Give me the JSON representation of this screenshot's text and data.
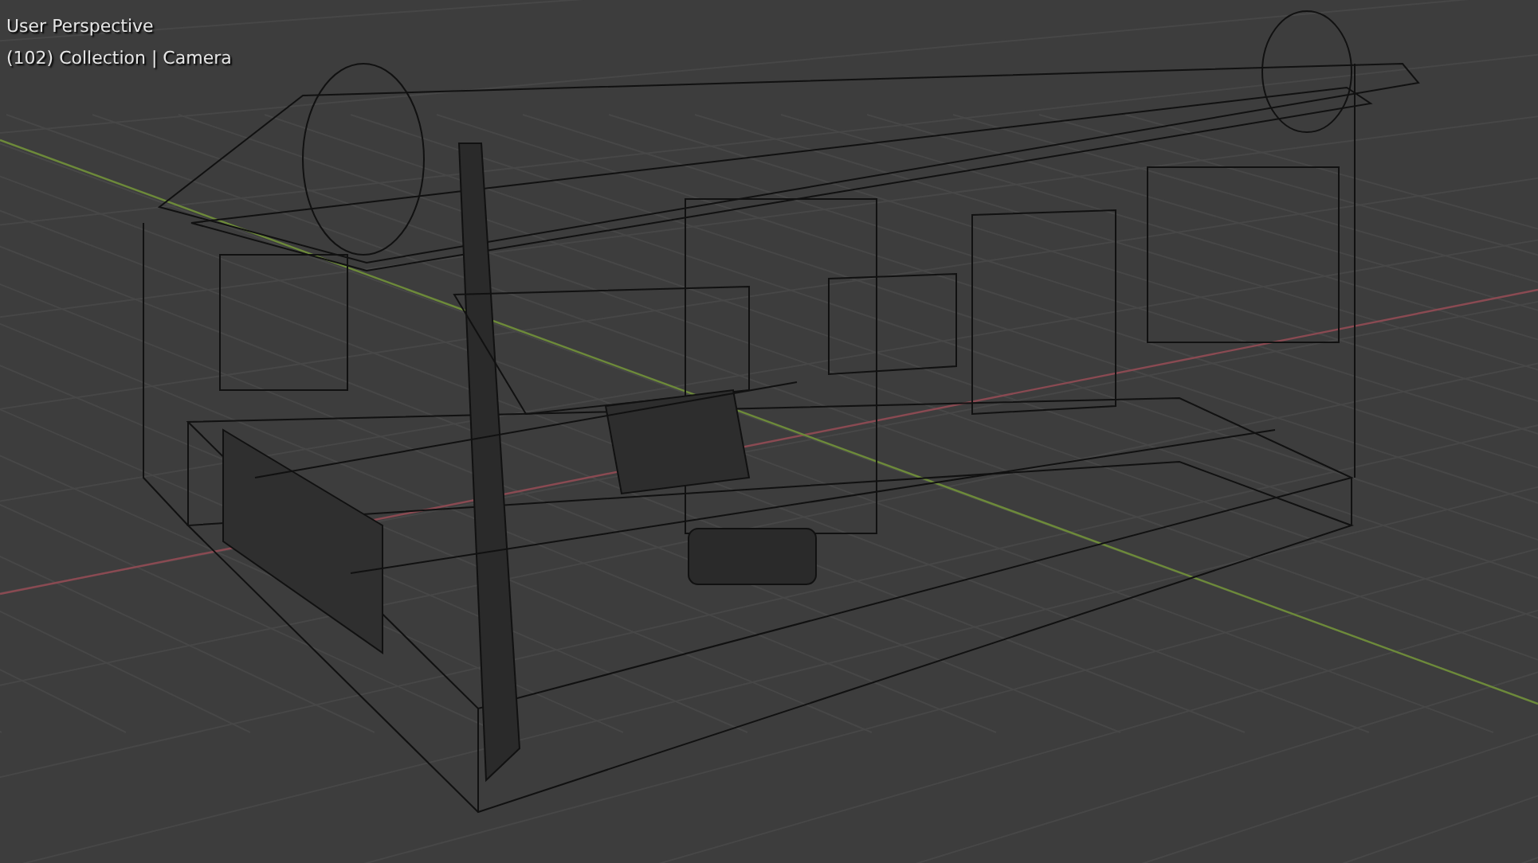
{
  "viewport": {
    "view_name": "User Perspective",
    "context": "(102) Collection | Camera"
  }
}
